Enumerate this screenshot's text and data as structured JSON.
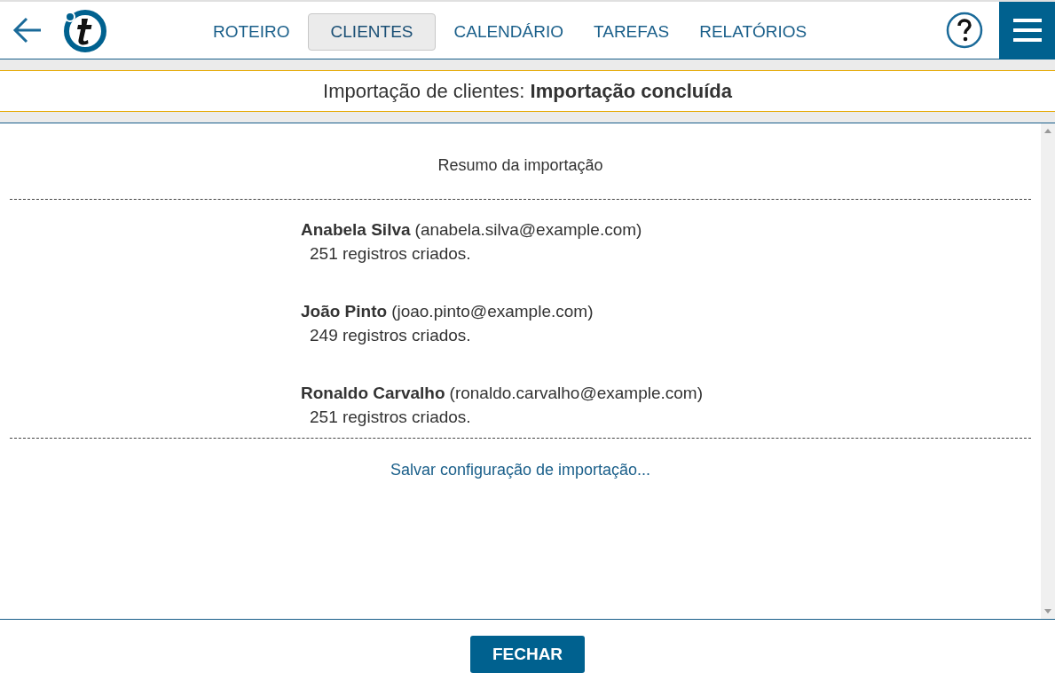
{
  "nav": {
    "tabs": [
      {
        "label": "ROTEIRO",
        "selected": false
      },
      {
        "label": "CLIENTES",
        "selected": true
      },
      {
        "label": "CALENDÁRIO",
        "selected": false
      },
      {
        "label": "TAREFAS",
        "selected": false
      },
      {
        "label": "RELATÓRIOS",
        "selected": false
      }
    ]
  },
  "header": {
    "title": "Importação de clientes: **Importação concluída**"
  },
  "summary": {
    "heading": "Resumo da importação",
    "users": [
      {
        "name": "Anabela Silva",
        "email": "(anabela.silva@example.com)",
        "result": "251 registros criados."
      },
      {
        "name": "João Pinto",
        "email": "(joao.pinto@example.com)",
        "result": "249 registros criados."
      },
      {
        "name": "Ronaldo Carvalho",
        "email": "(ronaldo.carvalho@example.com)",
        "result": "251 registros criados."
      }
    ],
    "save_link": "Salvar configuração de importação..."
  },
  "footer": {
    "button": "FECHAR"
  }
}
